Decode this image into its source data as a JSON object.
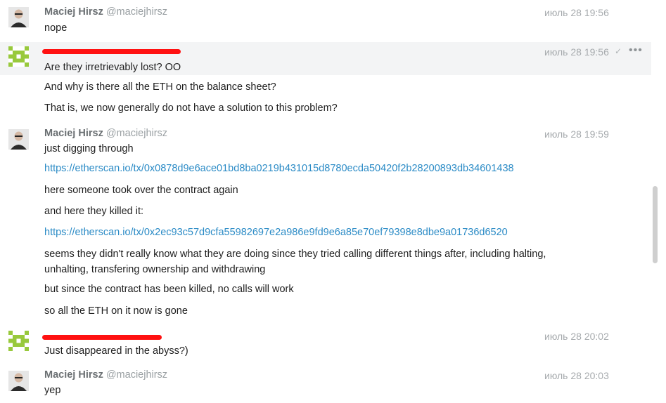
{
  "messages": [
    {
      "avatar": "photo",
      "name": "Maciej Hirsz",
      "handle": "@maciejhirsz",
      "time": "июль 28 19:56",
      "lines": [
        "nope"
      ]
    },
    {
      "avatar": "pixel",
      "name": "",
      "handle": "",
      "time": "июль 28 19:56",
      "redacted": true,
      "check": "✓",
      "more": "•••",
      "lines": [
        "Are they irretrievably lost? OO",
        "And why is there all the ETH on the balance sheet?",
        "That is, we now generally do not have a solution to this problem?"
      ]
    },
    {
      "avatar": "photo",
      "name": "Maciej Hirsz",
      "handle": "@maciejhirsz",
      "time": "июль 28 19:59",
      "lines": [
        "just digging through",
        "https://etherscan.io/tx/0x0878d9e6ace01bd8ba0219b431015d8780ecda50420f2b28200893db34601438",
        "here someone took over the contract again",
        "and here they killed it:",
        "https://etherscan.io/tx/0x2ec93c57d9cfa55982697e2a986e9fd9e6a85e70ef79398e8dbe9a01736d6520",
        "seems they didn't really know what they are doing since they tried calling different things after, including halting,",
        "unhalting, transfering ownership and withdrawing",
        "but since the contract has been killed, no calls will work",
        "so all the ETH on it now is gone"
      ]
    },
    {
      "avatar": "pixel",
      "name": "",
      "handle": "",
      "time": "июль 28 20:02",
      "redacted": true,
      "lines": [
        "Just disappeared in the abyss?)"
      ]
    },
    {
      "avatar": "photo",
      "name": "Maciej Hirsz",
      "handle": "@maciejhirsz",
      "time": "июль 28 20:03",
      "lines": [
        "yep"
      ]
    }
  ]
}
